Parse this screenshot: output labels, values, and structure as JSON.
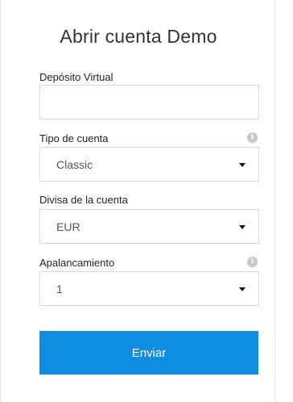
{
  "form": {
    "title": "Abrir cuenta Demo",
    "deposit": {
      "label": "Depósito Virtual",
      "value": ""
    },
    "account_type": {
      "label": "Tipo de cuenta",
      "selected": "Classic",
      "info_icon": "info-icon"
    },
    "currency": {
      "label": "Divisa de la cuenta",
      "selected": "EUR"
    },
    "leverage": {
      "label": "Apalancamiento",
      "selected": "1",
      "info_icon": "info-icon"
    },
    "submit_label": "Enviar"
  },
  "colors": {
    "accent": "#0f8de3",
    "border": "#d9d9d9",
    "info_icon": "#c8c8c8"
  }
}
